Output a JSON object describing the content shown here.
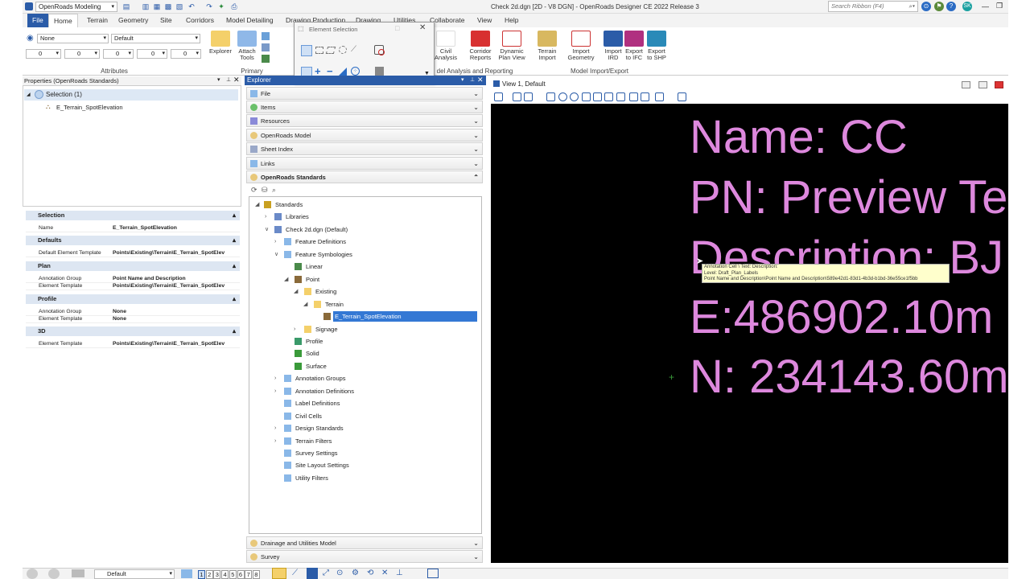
{
  "titlebar": {
    "workspace": "OpenRoads Modeling",
    "window_title": "Check 2d.dgn [2D - V8 DGN] - OpenRoads Designer CE 2022 Release 3",
    "search_placeholder": "Search Ribbon (F4)",
    "user_initials": "SK"
  },
  "tabs": [
    "File",
    "Home",
    "Terrain",
    "Geometry",
    "Site",
    "Corridors",
    "Model Detailing",
    "Drawing Production",
    "Drawing",
    "Utilities",
    "Collaborate",
    "View",
    "Help"
  ],
  "ribbon": {
    "attributes": {
      "level": "None",
      "style": "Default",
      "fields": [
        "0",
        "0",
        "0",
        "0",
        "0"
      ],
      "group_label": "Attributes"
    },
    "primary": {
      "explorer": "Explorer",
      "attach": "Attach",
      "attach2": "Tools",
      "group_label": "Primary"
    },
    "analysis": {
      "civil": "Civil",
      "civil2": "Analysis",
      "corridor": "Corridor",
      "corridor2": "Reports",
      "dynamic": "Dynamic",
      "dynamic2": "Plan View",
      "group_label": "Model Analysis and Reporting",
      "group_label_visible": "del Analysis and Reporting"
    },
    "import_export": {
      "terrain": "Terrain",
      "terrain2": "Import",
      "geometry": "Import",
      "geometry2": "Geometry",
      "ird": "Import",
      "ird2": "IRD",
      "ifc": "Export",
      "ifc2": "to IFC",
      "shp": "Export",
      "shp2": "to SHP",
      "group_label": "Model Import/Export"
    }
  },
  "element_selection": {
    "title": "Element Selection"
  },
  "properties": {
    "header": "Properties (OpenRoads Standards)",
    "tree_root": "Selection (1)",
    "tree_child": "E_Terrain_SpotElevation",
    "sections": [
      {
        "title": "Selection",
        "rows": [
          {
            "k": "Name",
            "v": "E_Terrain_SpotElevation"
          }
        ]
      },
      {
        "title": "Defaults",
        "rows": [
          {
            "k": "Default Element Template",
            "v": "Points\\Existing\\Terrain\\E_Terrain_SpotElev"
          }
        ]
      },
      {
        "title": "Plan",
        "rows": [
          {
            "k": "Annotation Group",
            "v": "Point Name and Description"
          },
          {
            "k": "Element Template",
            "v": "Points\\Existing\\Terrain\\E_Terrain_SpotElev"
          }
        ]
      },
      {
        "title": "Profile",
        "rows": [
          {
            "k": "Annotation Group",
            "v": "None"
          },
          {
            "k": "Element Template",
            "v": "None"
          }
        ]
      },
      {
        "title": "3D",
        "rows": [
          {
            "k": "Element Template",
            "v": "Points\\Existing\\Terrain\\E_Terrain_SpotElev"
          }
        ]
      }
    ]
  },
  "explorer": {
    "header": "Explorer",
    "sections": [
      "File",
      "Items",
      "Resources",
      "OpenRoads Model",
      "Sheet Index",
      "Links",
      "OpenRoads Standards"
    ],
    "bottom_sections": [
      "Drainage and Utilities Model",
      "Survey"
    ],
    "tree": [
      {
        "label": "Standards",
        "depth": 0,
        "toggle": "◢"
      },
      {
        "label": "Libraries",
        "depth": 1,
        "toggle": "›"
      },
      {
        "label": "Check 2d.dgn (Default)",
        "depth": 1,
        "toggle": "∨"
      },
      {
        "label": "Feature Definitions",
        "depth": 2,
        "toggle": "›"
      },
      {
        "label": "Feature Symbologies",
        "depth": 2,
        "toggle": "∨"
      },
      {
        "label": "Linear",
        "depth": 3,
        "toggle": ""
      },
      {
        "label": "Point",
        "depth": 3,
        "toggle": "◢"
      },
      {
        "label": "Existing",
        "depth": 4,
        "toggle": "◢"
      },
      {
        "label": "Terrain",
        "depth": 5,
        "toggle": "◢"
      },
      {
        "label": "E_Terrain_SpotElevation",
        "depth": 6,
        "toggle": "",
        "selected": true
      },
      {
        "label": "Signage",
        "depth": 4,
        "toggle": "›"
      },
      {
        "label": "Profile",
        "depth": 3,
        "toggle": ""
      },
      {
        "label": "Solid",
        "depth": 3,
        "toggle": ""
      },
      {
        "label": "Surface",
        "depth": 3,
        "toggle": ""
      },
      {
        "label": "Annotation Groups",
        "depth": 2,
        "toggle": "›"
      },
      {
        "label": "Annotation Definitions",
        "depth": 2,
        "toggle": "›"
      },
      {
        "label": "Label Definitions",
        "depth": 2,
        "toggle": ""
      },
      {
        "label": "Civil Cells",
        "depth": 2,
        "toggle": ""
      },
      {
        "label": "Design Standards",
        "depth": 2,
        "toggle": "›"
      },
      {
        "label": "Terrain Filters",
        "depth": 2,
        "toggle": "›"
      },
      {
        "label": "Survey Settings",
        "depth": 2,
        "toggle": ""
      },
      {
        "label": "Site Layout Settings",
        "depth": 2,
        "toggle": ""
      },
      {
        "label": "Utility Filters",
        "depth": 2,
        "toggle": ""
      }
    ]
  },
  "view": {
    "title": "View 1, Default",
    "lines": [
      "Name: CC",
      "PN: Preview Te",
      "Description: BJ",
      "E:486902.10m",
      "N: 234143.60m"
    ],
    "tooltip": [
      "Annotation Cell \\ Text: Description:",
      "Level: Draft_Plan_Labels",
      "Point Name and Description\\Point Name and Description\\589e42d1-83d1-4b3d-b1bd-36e55ce1f5bb"
    ]
  },
  "statusbar": {
    "view_group": "Default",
    "pages": [
      "1",
      "2",
      "3",
      "4",
      "5",
      "6",
      "7",
      "8"
    ]
  },
  "colors": {
    "accent": "#2b5ca8",
    "canvas_bg": "#000000",
    "canvas_text": "#dd88dd",
    "selected_row": "#3478d4"
  }
}
